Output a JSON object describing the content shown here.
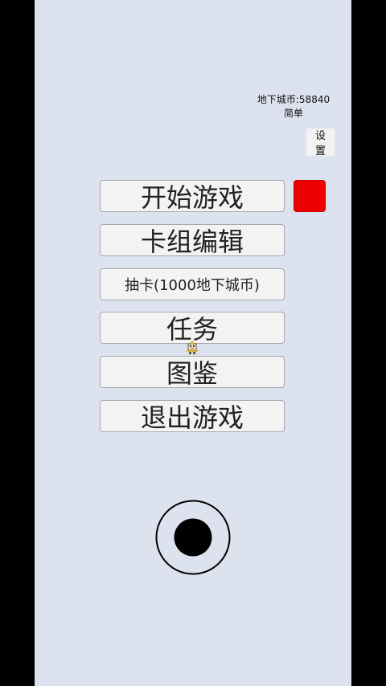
{
  "hud": {
    "currency": "地下城币:58840",
    "difficulty": "简单"
  },
  "settings": {
    "label": "设置"
  },
  "menu": {
    "start": "开始游戏",
    "deck_edit": "卡组编辑",
    "draw_card": "抽卡(1000地下城币)",
    "tasks": "任务",
    "collection": "图鉴",
    "exit": "退出游戏"
  },
  "colors": {
    "background": "#dce3ef",
    "button_fill": "#f3f3f3",
    "button_border": "#a8a8a8",
    "status_square": "#ee0000",
    "letterbox": "#000000"
  },
  "icons": {
    "mascot": "small-sprite-icon",
    "joystick": "virtual-joystick"
  }
}
